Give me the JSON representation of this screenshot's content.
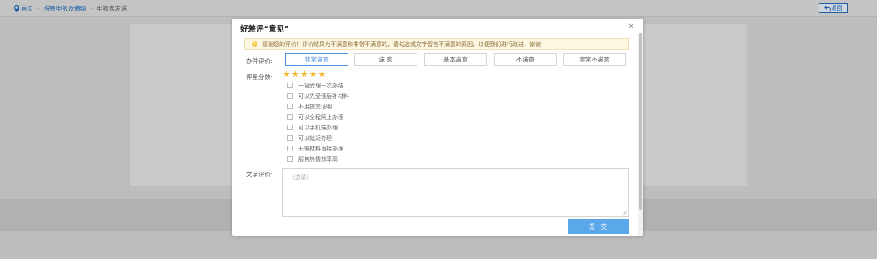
{
  "breadcrumb": {
    "home": "首页",
    "level1": "税费申报及缴纳",
    "current": "申报表发送",
    "separator": "-"
  },
  "back_button": {
    "label": "返回"
  },
  "modal": {
    "title": "好差评“意见”",
    "close": "×",
    "notice": "感谢您的评价！评价结果为不满意和非常不满意的，请勾选或文字留言不满意的原因，以便我们进行改进，谢谢!",
    "rating": {
      "label": "办件评价:",
      "options": [
        "非常满意",
        "满 意",
        "基本满意",
        "不满意",
        "非常不满意"
      ],
      "selected": "非常满意"
    },
    "stars": {
      "label": "评星分数:",
      "value": 5,
      "max": 5
    },
    "reasons": [
      "一窗受理一次办结",
      "可以先受理后补材料",
      "不用提交证明",
      "可以全程网上办理",
      "可以手机端办理",
      "可以就近办理",
      "无需材料直接办理",
      "服务热情效率高"
    ],
    "comment": {
      "label": "文字评价:",
      "placeholder": "（选填）",
      "value": ""
    },
    "submit": "提 交"
  },
  "colors": {
    "primary_link": "#1c5fa8",
    "active_border": "#4a90e2",
    "star": "#f2b01e",
    "submit_bg": "#5aa7ea",
    "notice_bg": "#fdf6e1"
  }
}
